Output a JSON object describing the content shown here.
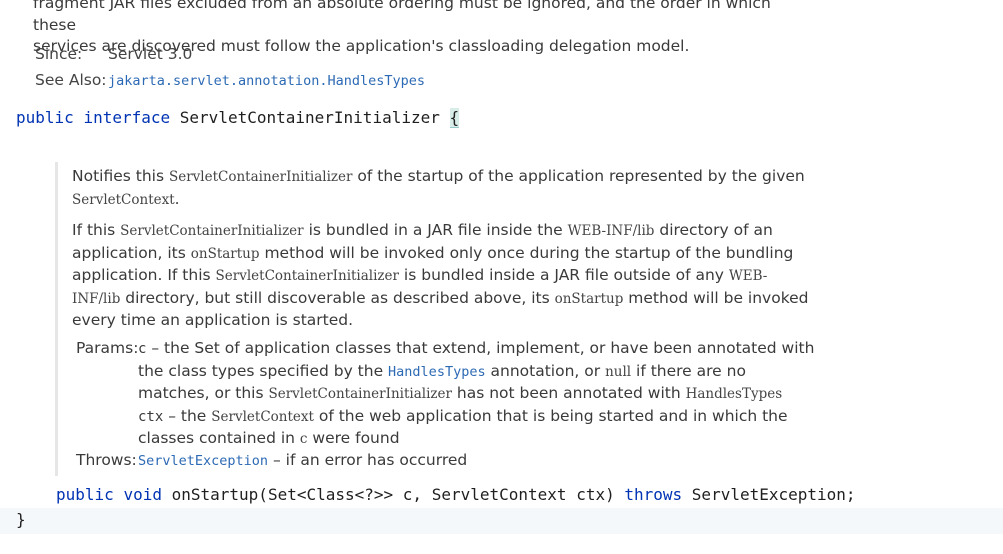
{
  "top_doc": {
    "line1": "fragment JAR files excluded from an absolute ordering must be ignored, and the order in which these",
    "line2": "services are discovered must follow the application's classloading delegation model."
  },
  "since": {
    "label": "Since:",
    "value": "Servlet 3.0"
  },
  "see_also": {
    "label": "See Also:",
    "link": "jakarta.servlet.annotation.HandlesTypes"
  },
  "interface_decl": {
    "kw_public": "public",
    "kw_interface": "interface",
    "name": "ServletContainerInitializer",
    "open_brace": "{"
  },
  "method_doc": {
    "p1_a": "Notifies this ",
    "p1_code1": "ServletContainerInitializer",
    "p1_b": " of the startup of the application represented by the given ",
    "p1_code2": "ServletContext",
    "p1_c": ".",
    "p2_a": "If this ",
    "p2_code1": "ServletContainerInitializer",
    "p2_b": " is bundled in a JAR file inside the ",
    "p2_code2": "WEB-INF/lib",
    "p2_c": " directory of an application, its ",
    "p2_code3": "onStartup",
    "p2_d": " method will be invoked only once during the startup of the bundling application. If this ",
    "p2_code4": "ServletContainerInitializer",
    "p2_e": " is bundled inside a JAR file outside of any ",
    "p2_code5": "WEB-INF/lib",
    "p2_f": " directory, but still discoverable as described above, its ",
    "p2_code6": "onStartup",
    "p2_g": " method will be invoked every time an application is started.",
    "params_label": "Params:",
    "param_c_name": "c",
    "param_c_a": " – the Set of application classes that extend, implement, or have been annotated with the class types specified by the ",
    "param_c_link": "HandlesTypes",
    "param_c_b": " annotation, or ",
    "param_c_null": "null",
    "param_c_c": " if there are no matches, or this ",
    "param_c_code": "ServletContainerInitializer",
    "param_c_d": " has not been annotated with ",
    "param_c_code2": "HandlesTypes",
    "param_ctx_name": "ctx",
    "param_ctx_a": " – the ",
    "param_ctx_code": "ServletContext",
    "param_ctx_b": " of the web application that is being started and in which the classes contained in ",
    "param_ctx_c": "c",
    "param_ctx_d": " were found",
    "throws_label": "Throws:",
    "throws_link": "ServletException",
    "throws_text": " – if an error has occurred"
  },
  "method_decl": {
    "kw_public": "public",
    "kw_void": "void",
    "signature": "onStartup(Set<Class<?>> c, ServletContext ctx)",
    "kw_throws": "throws",
    "exception": "ServletException;"
  },
  "close_brace": "}",
  "colors": {
    "keyword": "#0033b3",
    "link": "#2d6ab5",
    "caret_line": "#f5f8fa",
    "brace_match": "#d8ece8"
  }
}
